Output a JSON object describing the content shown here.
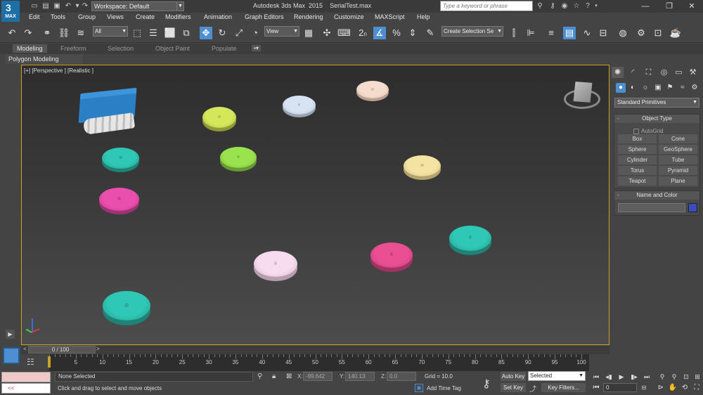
{
  "app": {
    "logo_big": "3",
    "logo_text": "MAX",
    "workspace": "Workspace: Default",
    "title": "Autodesk 3ds Max  2015    SerialTest.max",
    "search_placeholder": "Type a keyword or phrase"
  },
  "menu": [
    "Edit",
    "Tools",
    "Group",
    "Views",
    "Create",
    "Modifiers",
    "Animation",
    "Graph Editors",
    "Rendering",
    "Customize",
    "MAXScript",
    "Help"
  ],
  "toolbar": {
    "selection_filter": "All",
    "ref_coord": "View",
    "named_selection": "Create Selection Se",
    "snap_label": "2",
    "snap_sub": "n"
  },
  "ribbon": {
    "tabs": [
      "Modeling",
      "Freeform",
      "Selection",
      "Object Paint",
      "Populate"
    ],
    "panel": "Polygon Modeling"
  },
  "viewport": {
    "label": "[+] [Perspective ] [Realistic ]",
    "active_border_color": "#c9a227"
  },
  "command_panel": {
    "category": "Standard Primitives",
    "object_type_title": "Object Type",
    "autogrid": "AutoGrid",
    "buttons": [
      "Box",
      "Cone",
      "Sphere",
      "GeoSphere",
      "Cylinder",
      "Tube",
      "Torus",
      "Pyramid",
      "Teapot",
      "Plane"
    ],
    "name_color_title": "Name and Color",
    "swatch_color": "#3a4cc0"
  },
  "timeline": {
    "slider": "0 / 100",
    "ticks": [
      "5",
      "10",
      "15",
      "20",
      "25",
      "30",
      "35",
      "40",
      "45",
      "50",
      "55",
      "60",
      "65",
      "70",
      "75",
      "80",
      "85",
      "90",
      "95",
      "100"
    ]
  },
  "status": {
    "maxscript_prompt": "<<",
    "selection": "None Selected",
    "prompt": "Click and drag to select and move objects",
    "x_label": "X:",
    "x_value": "-99.642",
    "y_label": "Y:",
    "y_value": "140.13",
    "z_label": "Z:",
    "z_value": "0.0",
    "grid": "Grid = 10.0",
    "add_time_tag": "Add Time Tag",
    "auto_key": "Auto Key",
    "set_key": "Set Key",
    "key_mode": "Selected",
    "key_filters": "Key Filters...",
    "frame": "0"
  }
}
